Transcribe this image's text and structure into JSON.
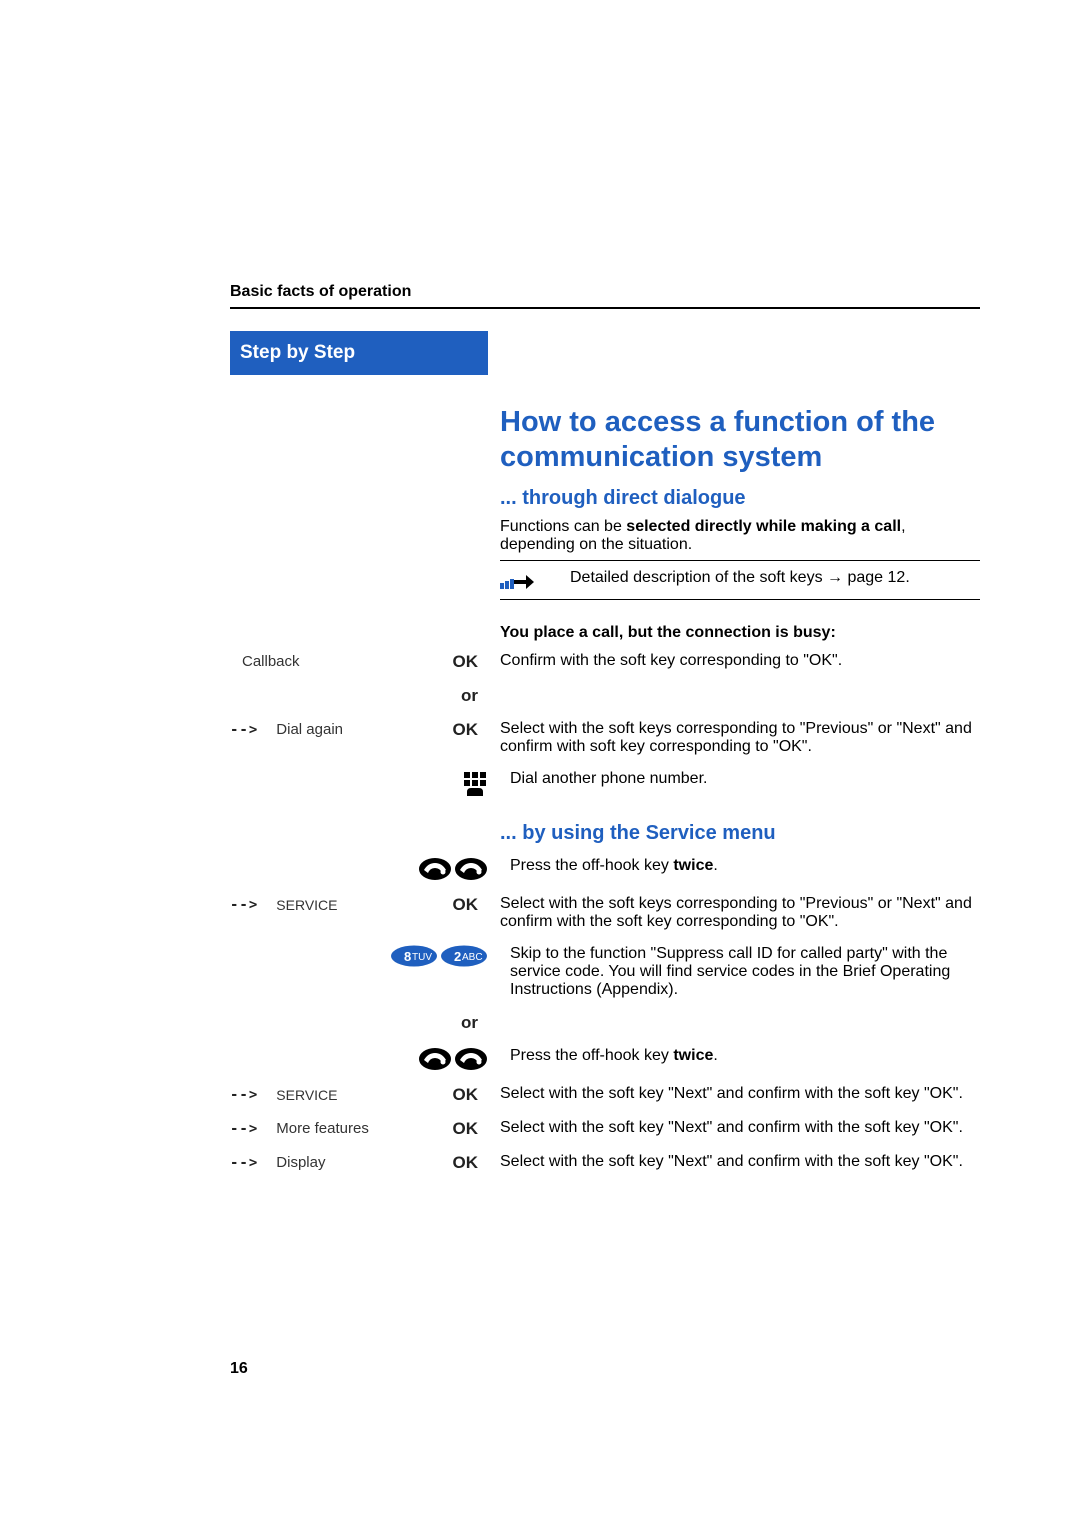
{
  "header": "Basic facts of operation",
  "sidebar_title": "Step by Step",
  "heading": "How to access a function of the communication system",
  "section1": {
    "title": "... through direct dialogue",
    "intro_pre": "Functions can be ",
    "intro_bold": "selected directly while making a call",
    "intro_post": ", depending on the situation.",
    "note_pre": "Detailed description of the soft keys ",
    "note_arrow": "→",
    "note_post": " page 12.",
    "subhead": "You place a call, but the connection is busy:",
    "steps": [
      {
        "left_label": "Callback",
        "left_ok": "OK",
        "right": "Confirm with the soft key corresponding to \"OK\"."
      },
      {
        "left_or": "or"
      },
      {
        "left_arrow": "-->",
        "left_label": "Dial again",
        "left_ok": "OK",
        "right": "Select with the soft keys corresponding to \"Previous\" or \"Next\" and confirm with soft key corresponding to \"OK\"."
      },
      {
        "left_icon": "keypad",
        "right": "Dial another phone number."
      }
    ]
  },
  "section2": {
    "title": "... by using the Service menu",
    "steps": [
      {
        "left_icon": "offhook-double",
        "right_pre": "Press the off-hook key ",
        "right_bold": "twice",
        "right_post": "."
      },
      {
        "left_arrow": "-->",
        "left_label": "SERVICE",
        "left_ok": "OK",
        "right": "Select with the soft keys corresponding to \"Previous\" or \"Next\" and confirm with the soft key corresponding to \"OK\"."
      },
      {
        "left_icon": "keys-8-2",
        "right": "Skip to the function \"Suppress call ID for called party\" with the service code. You will find service codes in the Brief Operating Instructions (Appendix)."
      },
      {
        "left_or": "or"
      },
      {
        "left_icon": "offhook-double",
        "right_pre": "Press the off-hook key ",
        "right_bold": "twice",
        "right_post": "."
      },
      {
        "left_arrow": "-->",
        "left_label": "SERVICE",
        "left_ok": "OK",
        "right": "Select with the soft key \"Next\" and confirm with the soft key \"OK\"."
      },
      {
        "left_arrow": "-->",
        "left_label": "More features",
        "left_ok": "OK",
        "right": "Select with the soft key \"Next\" and confirm with the soft key \"OK\"."
      },
      {
        "left_arrow": "-->",
        "left_label": "Display",
        "left_ok": "OK",
        "right": "Select with the soft key \"Next\" and confirm with the soft key \"OK\"."
      }
    ]
  },
  "page_number": "16",
  "icons": {
    "key8_num": "8",
    "key8_letters": "TUV",
    "key2_num": "2",
    "key2_letters": "ABC"
  }
}
